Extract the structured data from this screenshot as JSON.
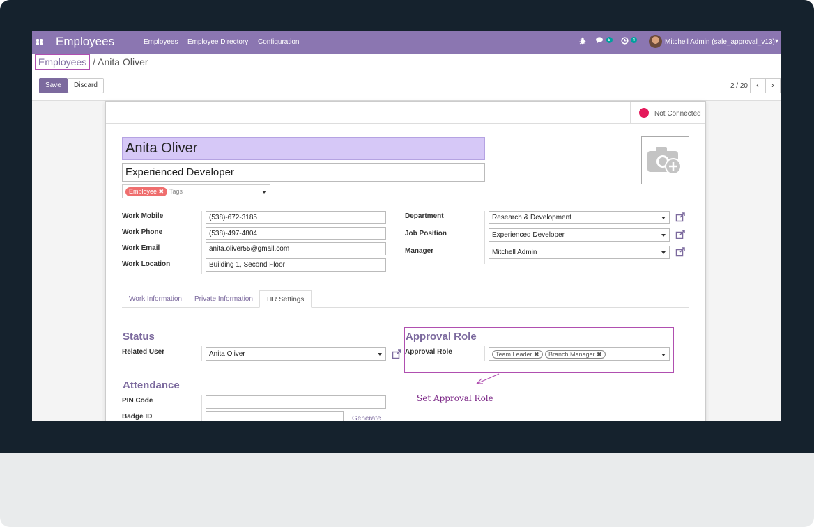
{
  "navbar": {
    "brand": "Employees",
    "menu": [
      "Employees",
      "Employee Directory",
      "Configuration"
    ],
    "messages_count": "9",
    "activities_count": "4",
    "user": "Mitchell Admin (sale_approval_v13)"
  },
  "breadcrumb": {
    "parent": "Employees",
    "separator": "/",
    "current": "Anita Oliver"
  },
  "buttons": {
    "save": "Save",
    "discard": "Discard"
  },
  "pager": {
    "value": "2 / 20",
    "prev": "‹",
    "next": "›"
  },
  "status": {
    "label": "Not Connected",
    "color": "#e4195b"
  },
  "employee": {
    "name": "Anita Oliver",
    "job_title": "Experienced Developer",
    "tag": "Employee",
    "tags_placeholder": "Tags"
  },
  "contact": {
    "work_mobile_label": "Work Mobile",
    "work_mobile": "(538)-672-3185",
    "work_phone_label": "Work Phone",
    "work_phone": "(538)-497-4804",
    "work_email_label": "Work Email",
    "work_email": "anita.oliver55@gmail.com",
    "work_location_label": "Work Location",
    "work_location": "Building 1, Second Floor"
  },
  "org": {
    "department_label": "Department",
    "department": "Research & Development",
    "job_position_label": "Job Position",
    "job_position": "Experienced Developer",
    "manager_label": "Manager",
    "manager": "Mitchell Admin"
  },
  "tabs": [
    "Work Information",
    "Private Information",
    "HR Settings"
  ],
  "hr_settings": {
    "status_title": "Status",
    "related_user_label": "Related User",
    "related_user": "Anita Oliver",
    "approval_title": "Approval Role",
    "approval_label": "Approval Role",
    "approval_roles": [
      "Team Leader",
      "Branch Manager"
    ],
    "annotation": "Set Approval Role",
    "attendance_title": "Attendance",
    "pin_label": "PIN Code",
    "badge_label": "Badge ID",
    "generate": "Generate"
  },
  "colors": {
    "primary": "#7c6a9e",
    "navbar": "#8b76b1",
    "highlight": "#b04fb0",
    "name_bg": "#d6c8f7"
  }
}
